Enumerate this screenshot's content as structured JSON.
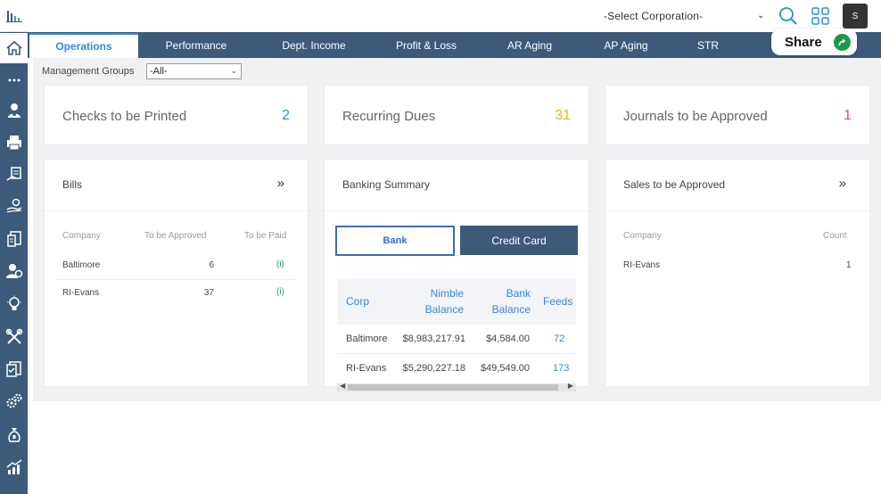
{
  "topbar": {
    "corporation_select": "-Select Corporation-",
    "avatar_initial": "S",
    "share_label": "Share"
  },
  "tabs": [
    {
      "label": "Operations",
      "active": true
    },
    {
      "label": "Performance",
      "active": false
    },
    {
      "label": "Dept. Income",
      "active": false
    },
    {
      "label": "Profit & Loss",
      "active": false
    },
    {
      "label": "AR Aging",
      "active": false
    },
    {
      "label": "AP Aging",
      "active": false
    },
    {
      "label": "STR",
      "active": false
    }
  ],
  "filters": {
    "management_groups_label": "Management Groups",
    "management_groups_value": "-All-"
  },
  "stats": {
    "checks": {
      "label": "Checks to be Printed",
      "value": "2",
      "color": "#2f8be0"
    },
    "recurring": {
      "label": "Recurring Dues",
      "value": "31",
      "color": "#f0b020"
    },
    "journals": {
      "label": "Journals to be Approved",
      "value": "1",
      "color": "#e8457a"
    }
  },
  "bills": {
    "title": "Bills",
    "columns": [
      "Company",
      "To be Approved",
      "To be Paid"
    ],
    "rows": [
      {
        "company": "Baltimore",
        "approved": "6",
        "paid": "(i)"
      },
      {
        "company": "RI-Evans",
        "approved": "37",
        "paid": "(i)"
      }
    ]
  },
  "banking": {
    "title": "Banking Summary",
    "bank_button": "Bank",
    "credit_card_button": "Credit Card",
    "columns": {
      "corp": "Corp",
      "nimble1": "Nimble",
      "nimble2": "Balance",
      "bank1": "Bank",
      "bank2": "Balance",
      "feeds": "Feeds"
    },
    "rows": [
      {
        "corp": "Baltimore",
        "nimble": "$8,983,217.91",
        "bank": "$4,584.00",
        "feeds": "72"
      },
      {
        "corp": "RI-Evans",
        "nimble": "$5,290,227.18",
        "bank": "$49,549.00",
        "feeds": "173"
      }
    ]
  },
  "sales": {
    "title": "Sales to be Approved",
    "columns": [
      "Company",
      "Count"
    ],
    "rows": [
      {
        "company": "RI-Evans",
        "count": "1"
      }
    ]
  },
  "sidebar_icons": [
    "menu-dots-icon",
    "user-settings-icon",
    "printer-icon",
    "invoice-hand-icon",
    "hand-coin-icon",
    "document-list-icon",
    "user-gear-icon",
    "lightbulb-icon",
    "tools-icon",
    "checklist-icon",
    "gears-icon",
    "money-bag-icon",
    "growth-chart-icon"
  ]
}
